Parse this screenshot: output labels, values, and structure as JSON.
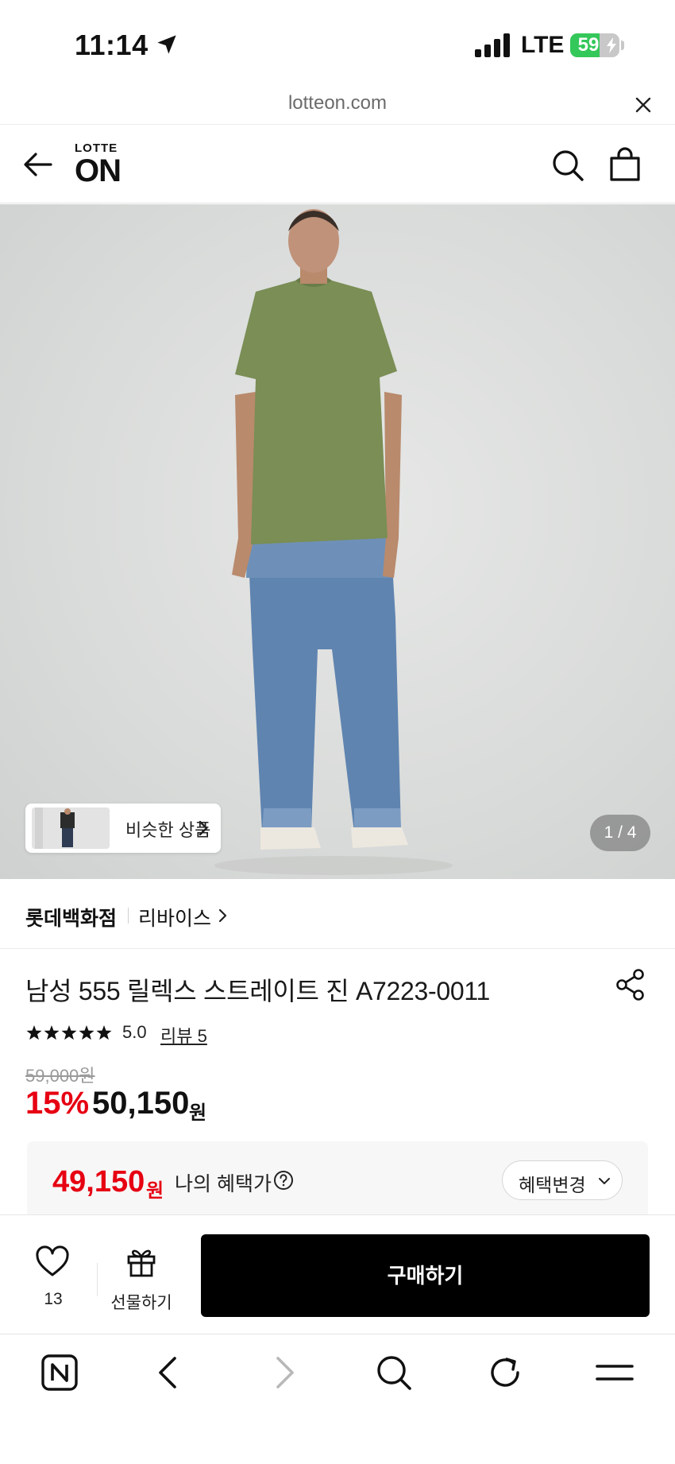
{
  "status_bar": {
    "time": "11:14",
    "network": "LTE",
    "battery": "59",
    "battery_level": 0.59
  },
  "browser": {
    "url": "lotteon.com"
  },
  "header": {
    "logo_top": "LOTTE",
    "logo_main": "ON"
  },
  "product_image": {
    "similar_label": "비슷한 상품",
    "counter": "1 / 4"
  },
  "brand": {
    "store": "롯데백화점",
    "brand_name": "리바이스"
  },
  "product": {
    "title": "남성 555 릴렉스 스트레이트 진 A7223-0011",
    "rating": "5.0",
    "stars": 5,
    "review_label": "리뷰 5",
    "original_price": "59,000원",
    "discount": "15%",
    "sale_price": "50,150",
    "sale_unit": "원",
    "benefit_price": "49,150",
    "benefit_unit": "원",
    "benefit_label": "나의 혜택가",
    "benefit_change": "혜택변경"
  },
  "purchase_bar": {
    "wish_count": "13",
    "gift_label": "선물하기",
    "buy_label": "구매하기"
  },
  "colors": {
    "accent_red": "#e60012",
    "battery_green": "#34c759",
    "buy_button": "#000000"
  },
  "icons": [
    "location-arrow-icon",
    "signal-icon",
    "battery-icon",
    "close-icon",
    "back-arrow-icon",
    "search-icon",
    "shopping-bag-icon",
    "chevron-right-icon",
    "share-icon",
    "star-icon",
    "help-icon",
    "chevron-down-icon",
    "heart-icon",
    "gift-icon",
    "naver-icon",
    "back-icon",
    "forward-icon",
    "refresh-icon",
    "menu-icon"
  ]
}
